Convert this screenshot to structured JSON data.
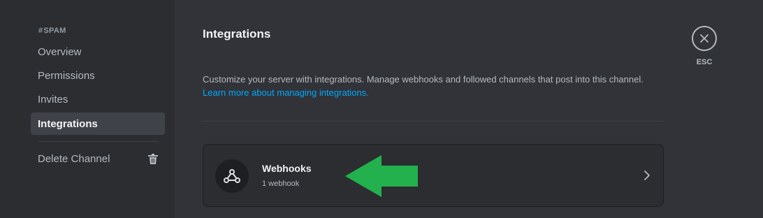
{
  "sidebar": {
    "channel_name": "SPAM",
    "items": [
      {
        "label": "Overview"
      },
      {
        "label": "Permissions"
      },
      {
        "label": "Invites"
      },
      {
        "label": "Integrations"
      }
    ],
    "delete_label": "Delete Channel"
  },
  "main": {
    "title": "Integrations",
    "description": "Customize your server with integrations. Manage webhooks and followed channels that post into this channel.",
    "link_text": "Learn more about managing integrations.",
    "card": {
      "title": "Webhooks",
      "subtitle": "1 webhook"
    }
  },
  "close": {
    "label": "ESC"
  },
  "colors": {
    "background": "#313338",
    "sidebar": "#2b2d31",
    "link": "#00a8fc",
    "annotation_arrow": "#22b14c"
  },
  "icons": [
    "hashtag-icon",
    "trash-icon",
    "webhook-icon",
    "chevron-right-icon",
    "close-icon",
    "green-arrow-icon"
  ]
}
